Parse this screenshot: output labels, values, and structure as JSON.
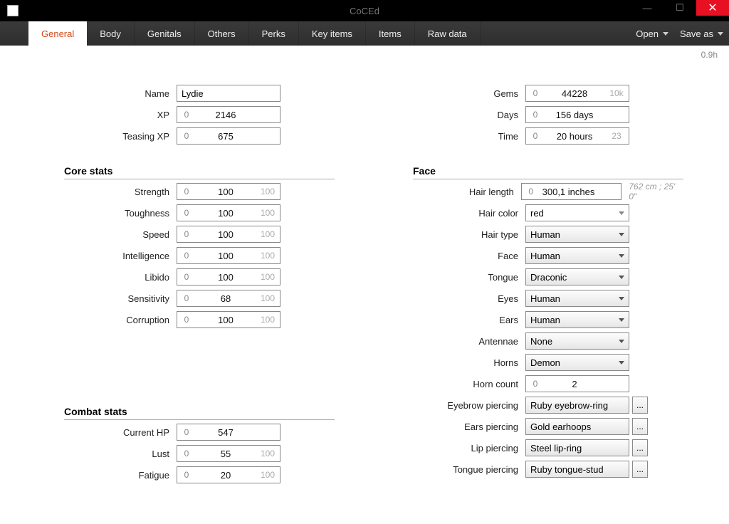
{
  "app": {
    "title": "CoCEd",
    "version": "0.9h"
  },
  "menus": {
    "open": "Open",
    "saveas": "Save as"
  },
  "tabs": [
    "General",
    "Body",
    "Genitals",
    "Others",
    "Perks",
    "Key items",
    "Items",
    "Raw data"
  ],
  "basic": {
    "name_label": "Name",
    "name_value": "Lydie",
    "xp_label": "XP",
    "xp_min": "0",
    "xp_value": "2146",
    "txp_label": "Teasing XP",
    "txp_min": "0",
    "txp_value": "675",
    "gems_label": "Gems",
    "gems_min": "0",
    "gems_value": "44228",
    "gems_max": "10k",
    "days_label": "Days",
    "days_min": "0",
    "days_value": "156 days",
    "time_label": "Time",
    "time_min": "0",
    "time_value": "20 hours",
    "time_max": "23"
  },
  "core": {
    "title": "Core stats",
    "rows": [
      {
        "label": "Strength",
        "min": "0",
        "val": "100",
        "max": "100"
      },
      {
        "label": "Toughness",
        "min": "0",
        "val": "100",
        "max": "100"
      },
      {
        "label": "Speed",
        "min": "0",
        "val": "100",
        "max": "100"
      },
      {
        "label": "Intelligence",
        "min": "0",
        "val": "100",
        "max": "100"
      },
      {
        "label": "Libido",
        "min": "0",
        "val": "100",
        "max": "100"
      },
      {
        "label": "Sensitivity",
        "min": "0",
        "val": "68",
        "max": "100"
      },
      {
        "label": "Corruption",
        "min": "0",
        "val": "100",
        "max": "100"
      }
    ]
  },
  "combat": {
    "title": "Combat stats",
    "rows": [
      {
        "label": "Current HP",
        "min": "0",
        "val": "547",
        "max": ""
      },
      {
        "label": "Lust",
        "min": "0",
        "val": "55",
        "max": "100"
      },
      {
        "label": "Fatigue",
        "min": "0",
        "val": "20",
        "max": "100"
      }
    ]
  },
  "face": {
    "title": "Face",
    "hairlen_label": "Hair length",
    "hairlen_min": "0",
    "hairlen_val": "300,1 inches",
    "hairlen_hint": "762 cm ; 25' 0\"",
    "haircolor_label": "Hair color",
    "haircolor_val": "red",
    "hairtype_label": "Hair type",
    "hairtype_val": "Human",
    "face_label": "Face",
    "face_val": "Human",
    "tongue_label": "Tongue",
    "tongue_val": "Draconic",
    "eyes_label": "Eyes",
    "eyes_val": "Human",
    "ears_label": "Ears",
    "ears_val": "Human",
    "antennae_label": "Antennae",
    "antennae_val": "None",
    "horns_label": "Horns",
    "horns_val": "Demon",
    "horncount_label": "Horn count",
    "horncount_min": "0",
    "horncount_val": "2",
    "eyebrowp_label": "Eyebrow piercing",
    "eyebrowp_val": "Ruby eyebrow-ring",
    "earsp_label": "Ears piercing",
    "earsp_val": "Gold earhoops",
    "lipp_label": "Lip piercing",
    "lipp_val": "Steel lip-ring",
    "tonguep_label": "Tongue piercing",
    "tonguep_val": "Ruby tongue-stud",
    "dots": "..."
  }
}
